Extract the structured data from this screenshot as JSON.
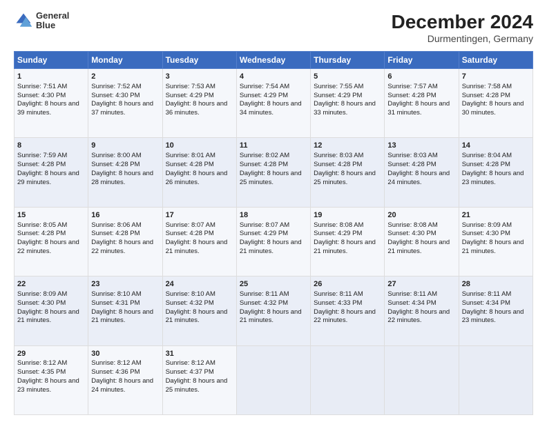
{
  "header": {
    "logo": {
      "line1": "General",
      "line2": "Blue"
    },
    "title": "December 2024",
    "subtitle": "Durmentingen, Germany"
  },
  "calendar": {
    "weekdays": [
      "Sunday",
      "Monday",
      "Tuesday",
      "Wednesday",
      "Thursday",
      "Friday",
      "Saturday"
    ],
    "weeks": [
      [
        {
          "day": 1,
          "sunrise": "7:51 AM",
          "sunset": "4:30 PM",
          "daylight": "8 hours and 39 minutes."
        },
        {
          "day": 2,
          "sunrise": "7:52 AM",
          "sunset": "4:30 PM",
          "daylight": "8 hours and 37 minutes."
        },
        {
          "day": 3,
          "sunrise": "7:53 AM",
          "sunset": "4:29 PM",
          "daylight": "8 hours and 36 minutes."
        },
        {
          "day": 4,
          "sunrise": "7:54 AM",
          "sunset": "4:29 PM",
          "daylight": "8 hours and 34 minutes."
        },
        {
          "day": 5,
          "sunrise": "7:55 AM",
          "sunset": "4:29 PM",
          "daylight": "8 hours and 33 minutes."
        },
        {
          "day": 6,
          "sunrise": "7:57 AM",
          "sunset": "4:28 PM",
          "daylight": "8 hours and 31 minutes."
        },
        {
          "day": 7,
          "sunrise": "7:58 AM",
          "sunset": "4:28 PM",
          "daylight": "8 hours and 30 minutes."
        }
      ],
      [
        {
          "day": 8,
          "sunrise": "7:59 AM",
          "sunset": "4:28 PM",
          "daylight": "8 hours and 29 minutes."
        },
        {
          "day": 9,
          "sunrise": "8:00 AM",
          "sunset": "4:28 PM",
          "daylight": "8 hours and 28 minutes."
        },
        {
          "day": 10,
          "sunrise": "8:01 AM",
          "sunset": "4:28 PM",
          "daylight": "8 hours and 26 minutes."
        },
        {
          "day": 11,
          "sunrise": "8:02 AM",
          "sunset": "4:28 PM",
          "daylight": "8 hours and 25 minutes."
        },
        {
          "day": 12,
          "sunrise": "8:03 AM",
          "sunset": "4:28 PM",
          "daylight": "8 hours and 25 minutes."
        },
        {
          "day": 13,
          "sunrise": "8:03 AM",
          "sunset": "4:28 PM",
          "daylight": "8 hours and 24 minutes."
        },
        {
          "day": 14,
          "sunrise": "8:04 AM",
          "sunset": "4:28 PM",
          "daylight": "8 hours and 23 minutes."
        }
      ],
      [
        {
          "day": 15,
          "sunrise": "8:05 AM",
          "sunset": "4:28 PM",
          "daylight": "8 hours and 22 minutes."
        },
        {
          "day": 16,
          "sunrise": "8:06 AM",
          "sunset": "4:28 PM",
          "daylight": "8 hours and 22 minutes."
        },
        {
          "day": 17,
          "sunrise": "8:07 AM",
          "sunset": "4:28 PM",
          "daylight": "8 hours and 21 minutes."
        },
        {
          "day": 18,
          "sunrise": "8:07 AM",
          "sunset": "4:29 PM",
          "daylight": "8 hours and 21 minutes."
        },
        {
          "day": 19,
          "sunrise": "8:08 AM",
          "sunset": "4:29 PM",
          "daylight": "8 hours and 21 minutes."
        },
        {
          "day": 20,
          "sunrise": "8:08 AM",
          "sunset": "4:30 PM",
          "daylight": "8 hours and 21 minutes."
        },
        {
          "day": 21,
          "sunrise": "8:09 AM",
          "sunset": "4:30 PM",
          "daylight": "8 hours and 21 minutes."
        }
      ],
      [
        {
          "day": 22,
          "sunrise": "8:09 AM",
          "sunset": "4:30 PM",
          "daylight": "8 hours and 21 minutes."
        },
        {
          "day": 23,
          "sunrise": "8:10 AM",
          "sunset": "4:31 PM",
          "daylight": "8 hours and 21 minutes."
        },
        {
          "day": 24,
          "sunrise": "8:10 AM",
          "sunset": "4:32 PM",
          "daylight": "8 hours and 21 minutes."
        },
        {
          "day": 25,
          "sunrise": "8:11 AM",
          "sunset": "4:32 PM",
          "daylight": "8 hours and 21 minutes."
        },
        {
          "day": 26,
          "sunrise": "8:11 AM",
          "sunset": "4:33 PM",
          "daylight": "8 hours and 22 minutes."
        },
        {
          "day": 27,
          "sunrise": "8:11 AM",
          "sunset": "4:34 PM",
          "daylight": "8 hours and 22 minutes."
        },
        {
          "day": 28,
          "sunrise": "8:11 AM",
          "sunset": "4:34 PM",
          "daylight": "8 hours and 23 minutes."
        }
      ],
      [
        {
          "day": 29,
          "sunrise": "8:12 AM",
          "sunset": "4:35 PM",
          "daylight": "8 hours and 23 minutes."
        },
        {
          "day": 30,
          "sunrise": "8:12 AM",
          "sunset": "4:36 PM",
          "daylight": "8 hours and 24 minutes."
        },
        {
          "day": 31,
          "sunrise": "8:12 AM",
          "sunset": "4:37 PM",
          "daylight": "8 hours and 25 minutes."
        },
        null,
        null,
        null,
        null
      ]
    ]
  }
}
